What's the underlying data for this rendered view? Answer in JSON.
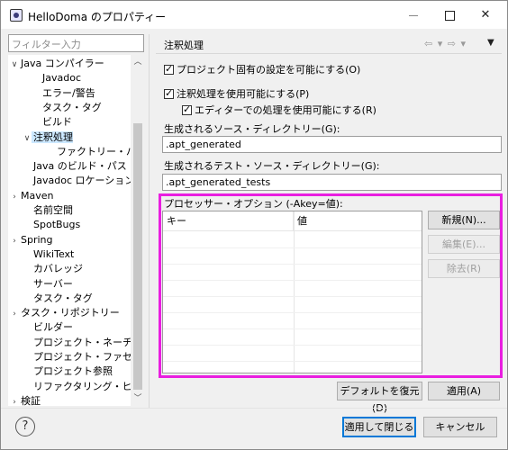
{
  "window": {
    "title": "HelloDoma のプロパティー"
  },
  "left": {
    "filter_placeholder": "フィルター入力",
    "tree": [
      {
        "label": "Java コンパイラー",
        "indent": 0,
        "twisty": "v"
      },
      {
        "label": "Javadoc",
        "indent": 2,
        "twisty": ""
      },
      {
        "label": "エラー/警告",
        "indent": 2,
        "twisty": ""
      },
      {
        "label": "タスク・タグ",
        "indent": 2,
        "twisty": ""
      },
      {
        "label": "ビルド",
        "indent": 2,
        "twisty": ""
      },
      {
        "label": "注釈処理",
        "indent": 1,
        "twisty": "v",
        "selected": true
      },
      {
        "label": "ファクトリー・パス",
        "indent": 3,
        "twisty": ""
      },
      {
        "label": "Java のビルド・パス",
        "indent": 1,
        "twisty": ""
      },
      {
        "label": "Javadoc ロケーション",
        "indent": 1,
        "twisty": ""
      },
      {
        "label": "Maven",
        "indent": 0,
        "twisty": ">"
      },
      {
        "label": "名前空間",
        "indent": 1,
        "twisty": ""
      },
      {
        "label": "SpotBugs",
        "indent": 1,
        "twisty": ""
      },
      {
        "label": "Spring",
        "indent": 0,
        "twisty": ">"
      },
      {
        "label": "WikiText",
        "indent": 1,
        "twisty": ""
      },
      {
        "label": "カバレッジ",
        "indent": 1,
        "twisty": ""
      },
      {
        "label": "サーバー",
        "indent": 1,
        "twisty": ""
      },
      {
        "label": "タスク・タグ",
        "indent": 1,
        "twisty": ""
      },
      {
        "label": "タスク・リポジトリー",
        "indent": 0,
        "twisty": ">"
      },
      {
        "label": "ビルダー",
        "indent": 1,
        "twisty": ""
      },
      {
        "label": "プロジェクト・ネーチャー",
        "indent": 1,
        "twisty": ""
      },
      {
        "label": "プロジェクト・ファセット",
        "indent": 1,
        "twisty": ""
      },
      {
        "label": "プロジェクト参照",
        "indent": 1,
        "twisty": ""
      },
      {
        "label": "リファクタリング・ヒストリー",
        "indent": 1,
        "twisty": ""
      },
      {
        "label": "検証",
        "indent": 0,
        "twisty": ">"
      }
    ]
  },
  "right": {
    "page_title": "注釈処理",
    "nav_icons": "⇦ ▾ ⇨ ▾",
    "nav_menu": "▼",
    "enable_project_specific": "プロジェクト固有の設定を可能にする(O)",
    "enable_annotation_processing": "注釈処理を使用可能にする(P)",
    "enable_in_editor": "エディターでの処理を使用可能にする(R)",
    "source_dir_label": "生成されるソース・ディレクトリー(G):",
    "source_dir_value": ".apt_generated",
    "test_source_dir_label": "生成されるテスト・ソース・ディレクトリー(G):",
    "test_source_dir_value": ".apt_generated_tests",
    "processor_options_label": "プロセッサー・オプション (-Akey=値):",
    "table_headers": [
      "キー",
      "値"
    ],
    "btn_new": "新規(N)...",
    "btn_edit": "編集(E)...",
    "btn_remove": "除去(R)",
    "btn_restore_defaults": "デフォルトを復元(D)",
    "btn_apply": "適用(A)"
  },
  "footer": {
    "help": "?",
    "btn_apply_close": "適用して閉じる",
    "btn_cancel": "キャンセル"
  },
  "colors": {
    "highlight": "#e91ee0",
    "selection": "#cce8ff",
    "default_button_border": "#0078d7"
  }
}
